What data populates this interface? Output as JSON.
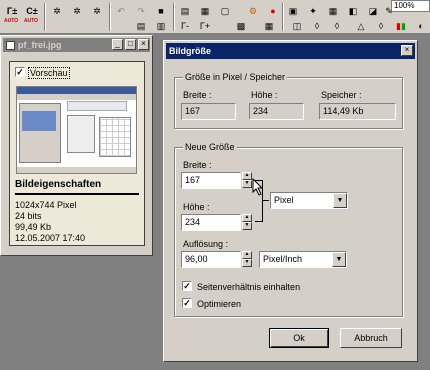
{
  "toolbar": {
    "auto_label": "AUTO",
    "zoom": "100%"
  },
  "preview_window": {
    "title": "pf_frei.jpg",
    "preview_label": "Vorschau",
    "properties_title": "Bildeigenschaften",
    "properties": [
      "1024x744 Pixel",
      "24 bits",
      "99,49 Kb",
      "12.05.2007 17:40"
    ]
  },
  "dialog": {
    "title": "Bildgröße",
    "current_group": {
      "title": "Größe in Pixel / Speicher",
      "width_label": "Breite :",
      "width_value": "167",
      "height_label": "Höhe :",
      "height_value": "234",
      "memory_label": "Speicher :",
      "memory_value": "114,49 Kb"
    },
    "new_group": {
      "title": "Neue Größe",
      "width_label": "Breite :",
      "width_value": "167",
      "height_label": "Höhe :",
      "height_value": "234",
      "unit_value": "Pixel",
      "resolution_label": "Auflösung :",
      "resolution_value": "96,00",
      "resolution_unit": "Pixel/Inch",
      "keep_ratio_label": "Seitenverhältnis einhalten",
      "optimize_label": "Optimieren"
    },
    "ok_label": "Ok",
    "cancel_label": "Abbruch"
  }
}
